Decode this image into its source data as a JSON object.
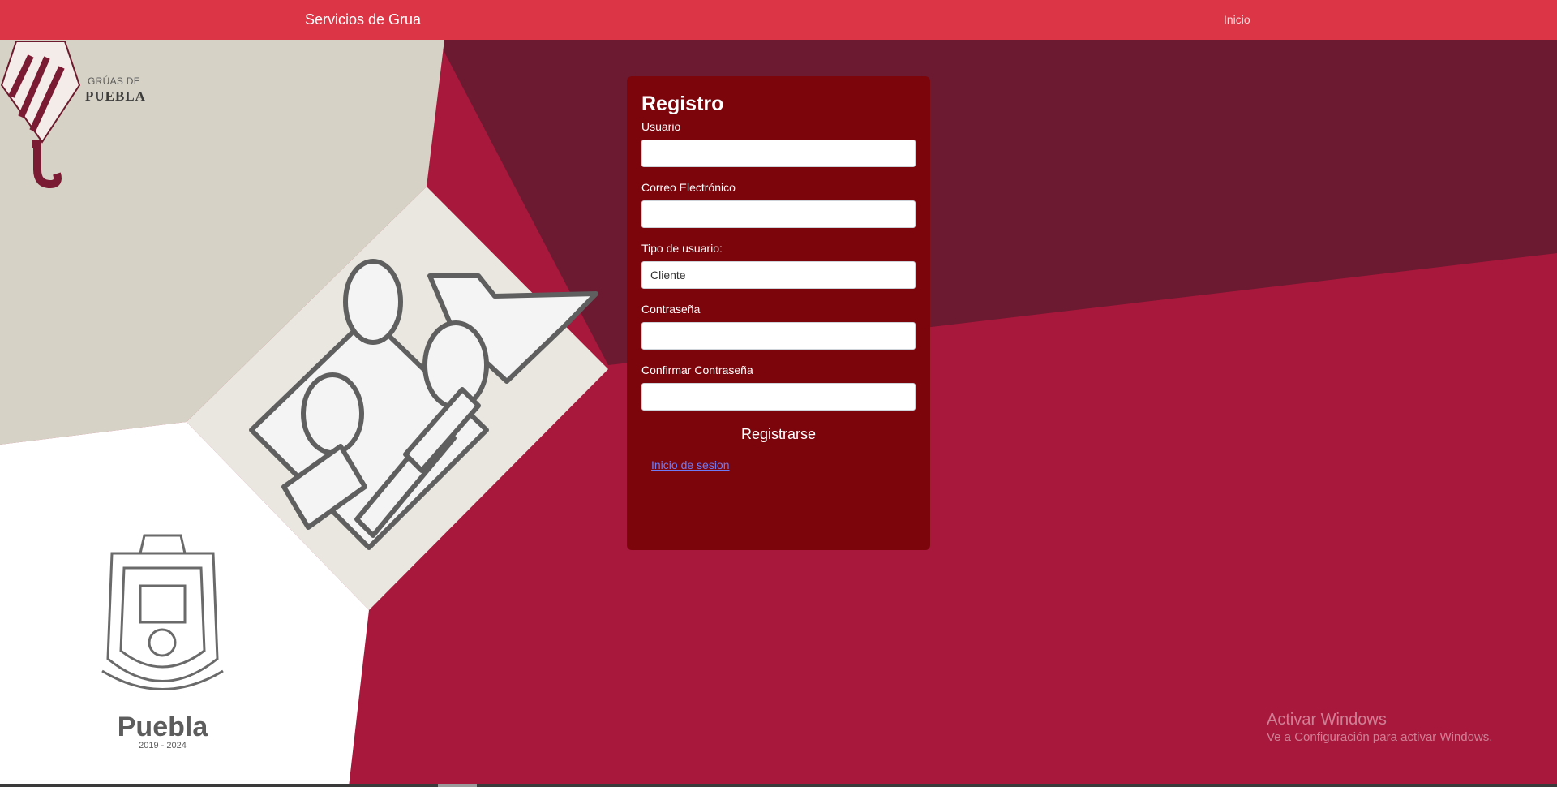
{
  "navbar": {
    "brand": "Servicios de Grua",
    "links": [
      "Inicio"
    ]
  },
  "logo": {
    "line1": "GRÚAS DE",
    "line2": "PUEBLA"
  },
  "coat_of_arms": {
    "name": "Puebla",
    "years": "2019 - 2024"
  },
  "form": {
    "title": "Registro",
    "fields": [
      {
        "label": "Usuario",
        "value": ""
      },
      {
        "label": "Correo Electrónico",
        "value": ""
      },
      {
        "label": "Tipo de usuario:",
        "value": "Cliente"
      },
      {
        "label": "Contraseña",
        "value": ""
      },
      {
        "label": "Confirmar Contraseña",
        "value": ""
      }
    ],
    "submit_label": "Registrarse",
    "login_link": "Inicio de sesion"
  },
  "watermark": {
    "title": "Activar Windows",
    "subtitle": "Ve a Configuración para activar Windows."
  },
  "colors": {
    "navbar": "#dc3545",
    "card": "#7c050c",
    "background_crimson": "#a8173c",
    "background_wine": "#6b1a31",
    "background_beige": "#d6d2c5"
  }
}
